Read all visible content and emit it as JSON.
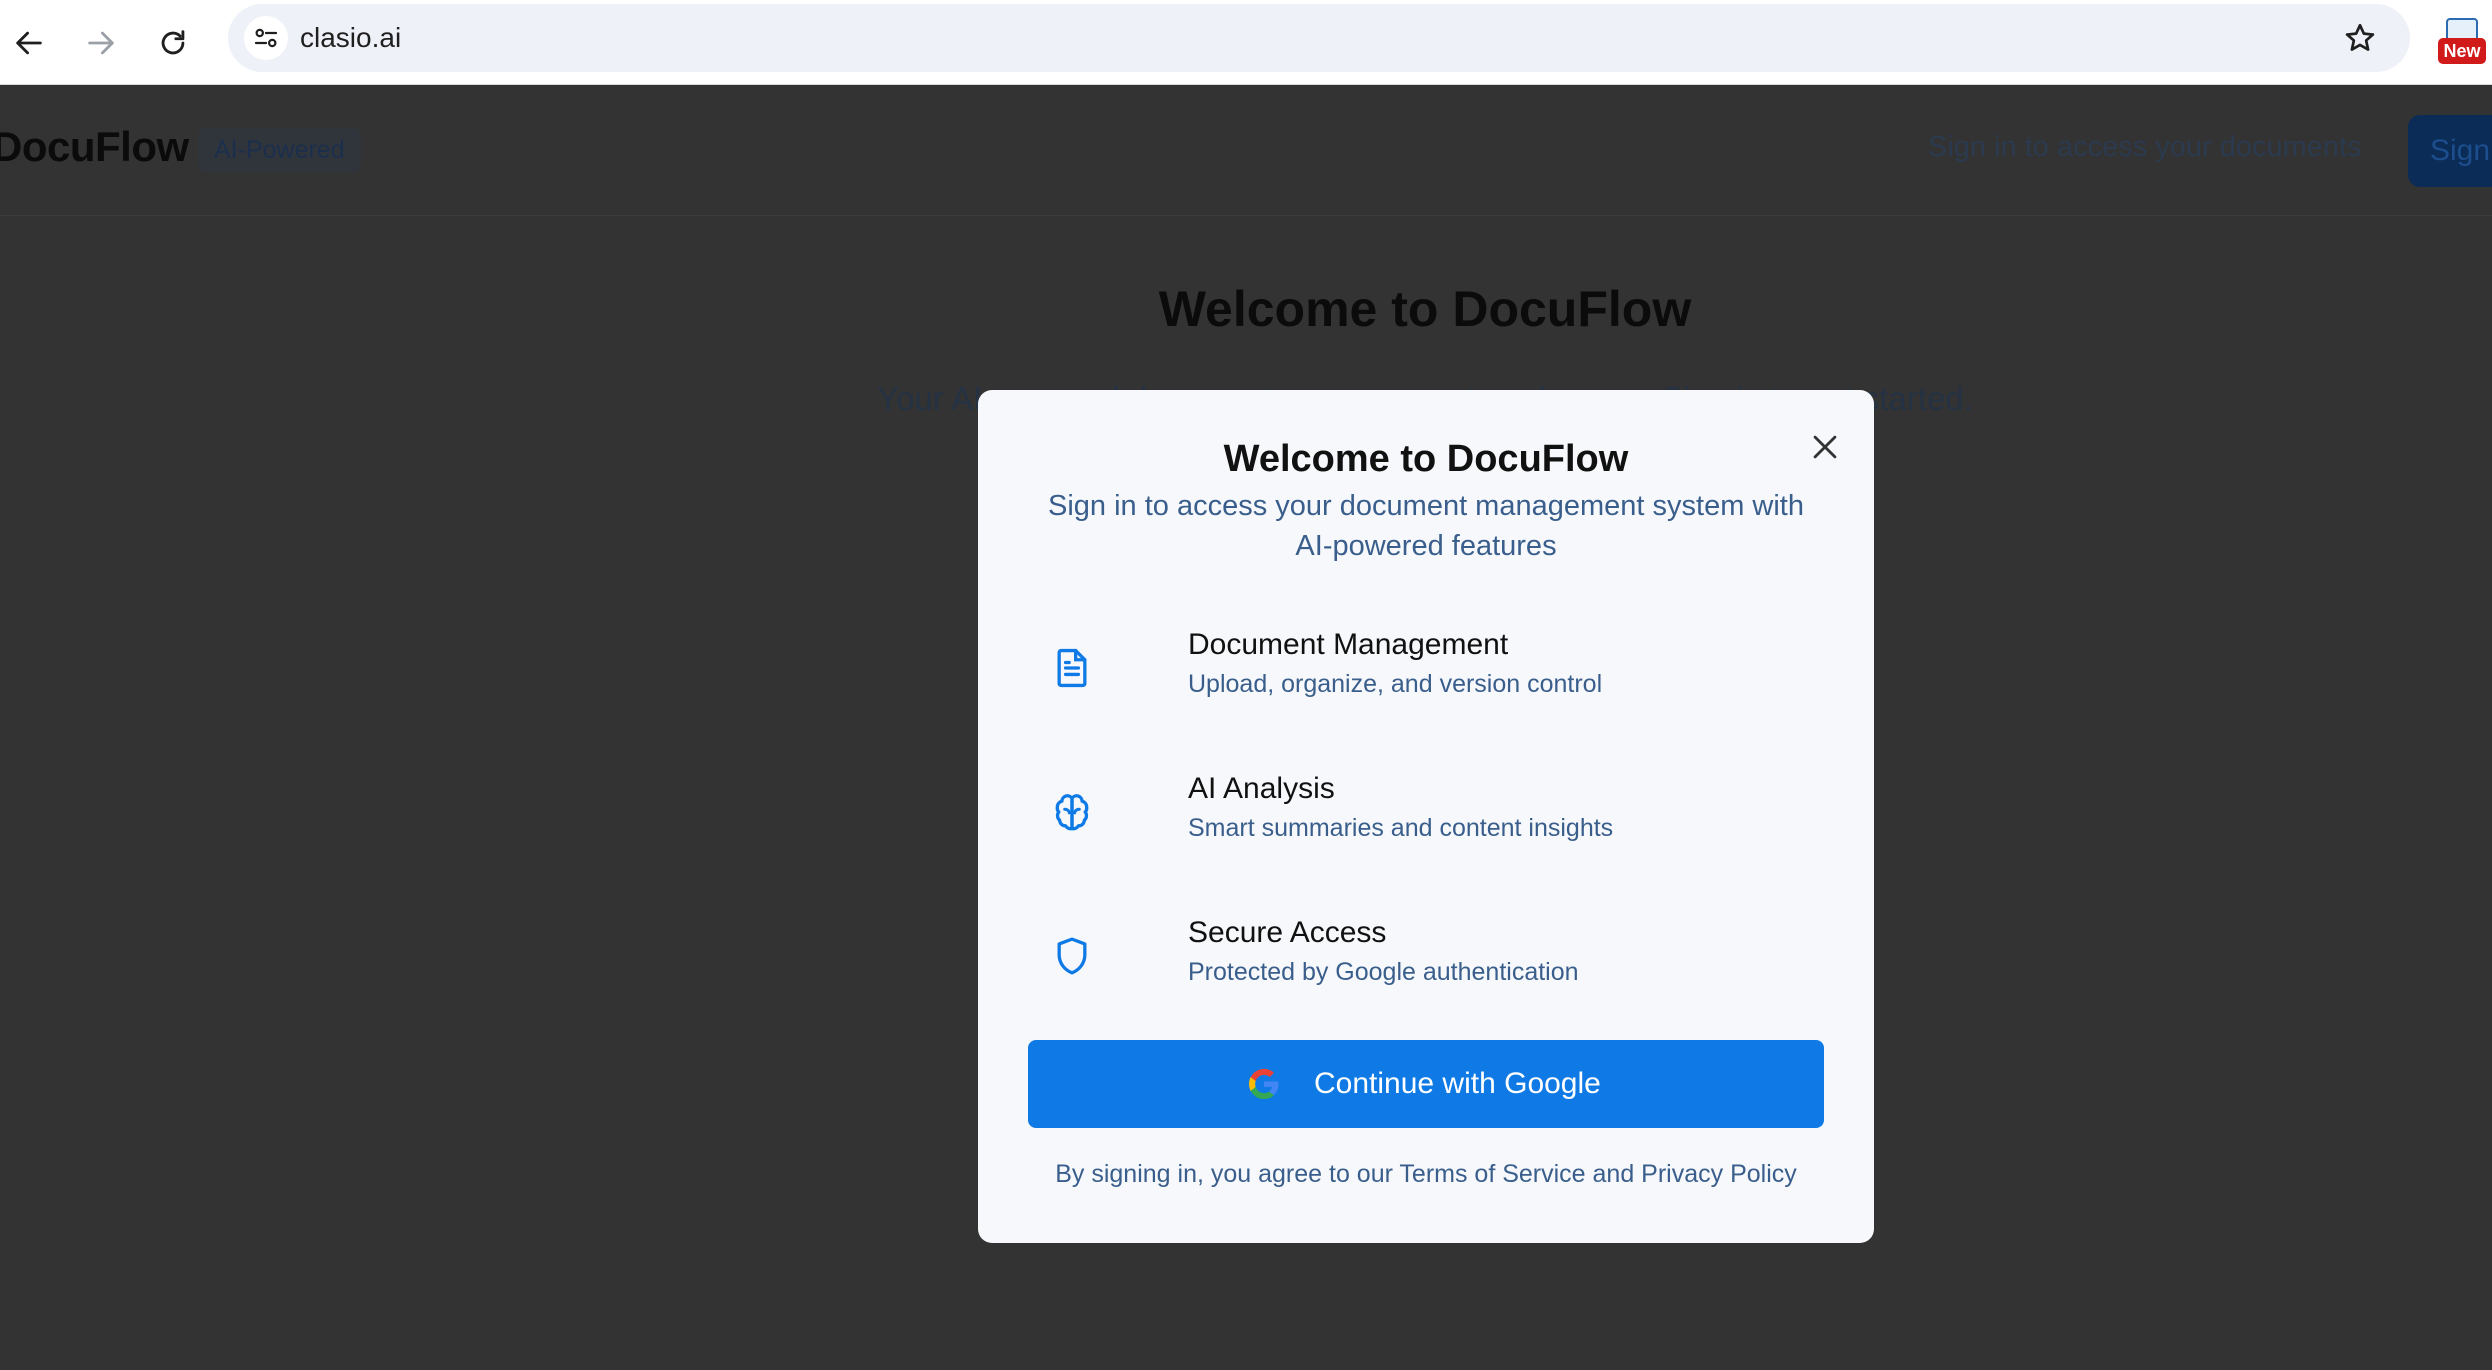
{
  "browser": {
    "url": "clasio.ai",
    "extension_badge": "New"
  },
  "app": {
    "brand": "DocuFlow",
    "brand_badge": "AI-Powered",
    "header_note": "Sign in to access your documents",
    "header_signin": "Sign",
    "hero_title": "Welcome to DocuFlow",
    "hero_subtitle": "Your AI-powered document management workspace. Sign in to get started."
  },
  "modal": {
    "title": "Welcome to DocuFlow",
    "subtitle": "Sign in to access your document management system with AI-powered features",
    "features": [
      {
        "icon": "document-icon",
        "title": "Document Management",
        "description": "Upload, organize, and version control"
      },
      {
        "icon": "brain-icon",
        "title": "AI Analysis",
        "description": "Smart summaries and content insights"
      },
      {
        "icon": "shield-icon",
        "title": "Secure Access",
        "description": "Protected by Google authentication"
      }
    ],
    "google_button": "Continue with Google",
    "legal": "By signing in, you agree to our Terms of Service and Privacy Policy"
  },
  "colors": {
    "primary": "#0f7ae5",
    "overlay": "#333333",
    "muted_text": "#3a5e8c"
  }
}
